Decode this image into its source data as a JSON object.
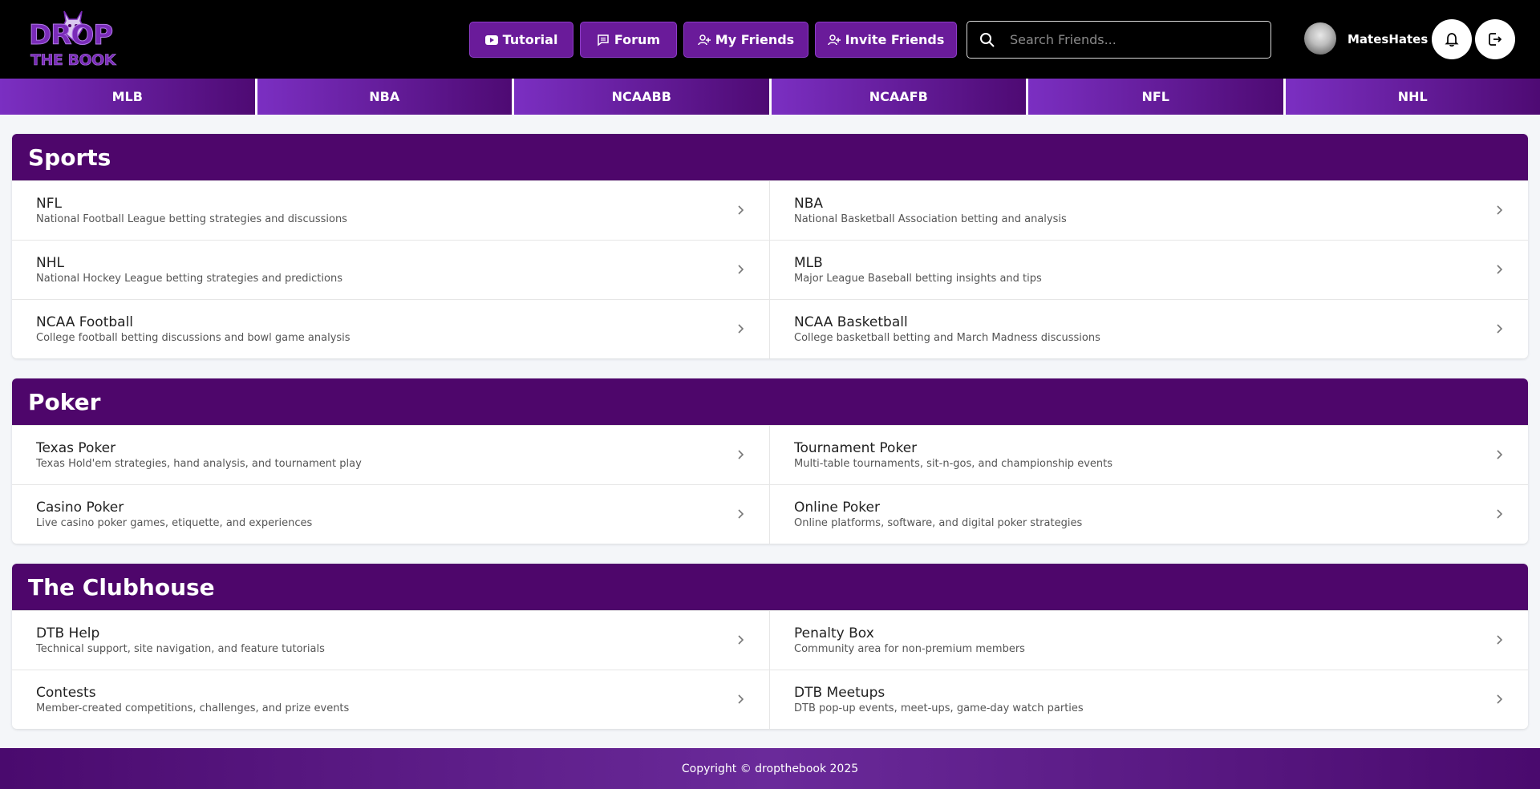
{
  "header": {
    "logo_line1": "DROP",
    "logo_line2": "THE BOOK",
    "buttons": {
      "tutorial": "Tutorial",
      "forum": "Forum",
      "my_friends": "My Friends",
      "invite_friends": "Invite Friends"
    },
    "search_placeholder": "Search Friends...",
    "username": "MatesHates"
  },
  "tabs": [
    "MLB",
    "NBA",
    "NCAABB",
    "NCAAFB",
    "NFL",
    "NHL"
  ],
  "sections": [
    {
      "title": "Sports",
      "items": [
        {
          "title": "NFL",
          "desc": "National Football League betting strategies and discussions"
        },
        {
          "title": "NBA",
          "desc": "National Basketball Association betting and analysis"
        },
        {
          "title": "NHL",
          "desc": "National Hockey League betting strategies and predictions"
        },
        {
          "title": "MLB",
          "desc": "Major League Baseball betting insights and tips"
        },
        {
          "title": "NCAA Football",
          "desc": "College football betting discussions and bowl game analysis"
        },
        {
          "title": "NCAA Basketball",
          "desc": "College basketball betting and March Madness discussions"
        }
      ]
    },
    {
      "title": "Poker",
      "items": [
        {
          "title": "Texas Poker",
          "desc": "Texas Hold'em strategies, hand analysis, and tournament play"
        },
        {
          "title": "Tournament Poker",
          "desc": "Multi-table tournaments, sit-n-gos, and championship events"
        },
        {
          "title": "Casino Poker",
          "desc": "Live casino poker games, etiquette, and experiences"
        },
        {
          "title": "Online Poker",
          "desc": "Online platforms, software, and digital poker strategies"
        }
      ]
    },
    {
      "title": "The Clubhouse",
      "items": [
        {
          "title": "DTB Help",
          "desc": "Technical support, site navigation, and feature tutorials"
        },
        {
          "title": "Penalty Box",
          "desc": "Community area for non-premium members"
        },
        {
          "title": "Contests",
          "desc": "Member-created competitions, challenges, and prize events"
        },
        {
          "title": "DTB Meetups",
          "desc": "DTB pop-up events, meet-ups, game-day watch parties"
        }
      ]
    }
  ],
  "footer": {
    "text": "Copyright © dropthebook 2025"
  },
  "colors": {
    "brand_purple": "#4e066b",
    "button_purple": "#6a1b9a"
  }
}
